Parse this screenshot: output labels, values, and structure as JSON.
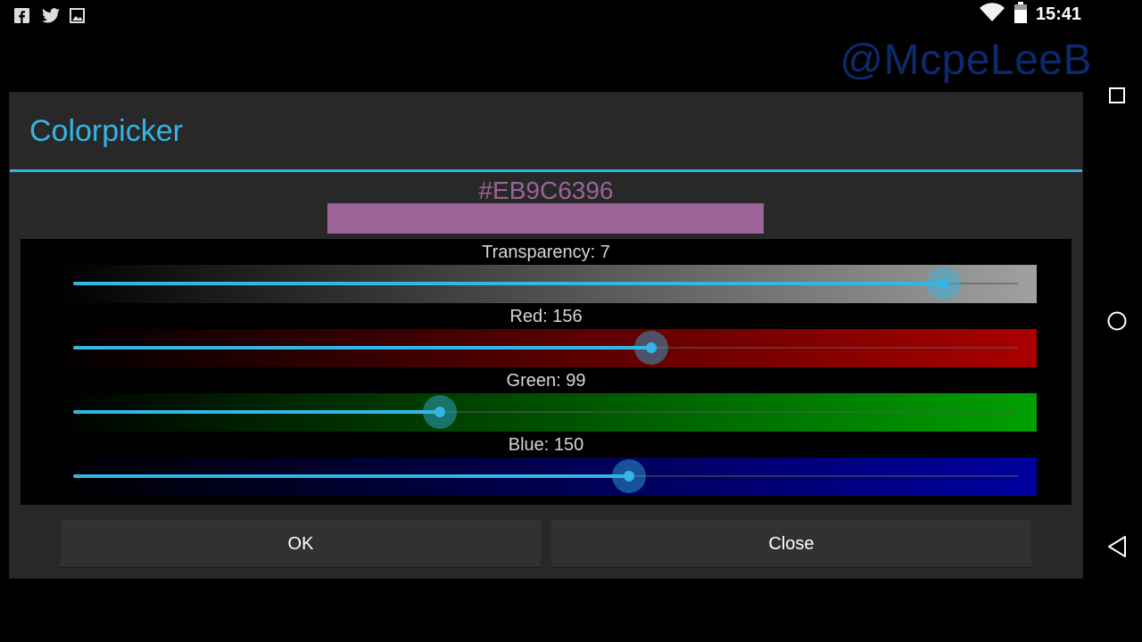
{
  "status_bar": {
    "left_icons": [
      "facebook-icon",
      "twitter-icon",
      "image-icon"
    ],
    "right_icons": [
      "wifi-icon",
      "battery-icon"
    ],
    "time": "15:41"
  },
  "watermark": "@McpeLeeB",
  "navbar": {
    "icons": [
      "recents-square-icon",
      "home-circle-icon",
      "back-triangle-icon"
    ]
  },
  "dialog": {
    "title": "Colorpicker",
    "hex_value": "#EB9C6396",
    "swatch_color": "#9c6396",
    "accent_color": "#33b5e5",
    "sliders": [
      {
        "key": "transparency",
        "label": "Transparency: 7",
        "name": "Transparency",
        "value": 235,
        "max": 255,
        "gradient": [
          "#000000",
          "#a0a0a0"
        ]
      },
      {
        "key": "red",
        "label": "Red: 156",
        "name": "Red",
        "value": 156,
        "max": 255,
        "gradient": [
          "#000000",
          "#aa0000"
        ]
      },
      {
        "key": "green",
        "label": "Green: 99",
        "name": "Green",
        "value": 99,
        "max": 255,
        "gradient": [
          "#000000",
          "#00a000"
        ]
      },
      {
        "key": "blue",
        "label": "Blue: 150",
        "name": "Blue",
        "value": 150,
        "max": 255,
        "gradient": [
          "#000000",
          "#0000a0"
        ]
      }
    ],
    "buttons": {
      "ok": "OK",
      "close": "Close"
    }
  }
}
